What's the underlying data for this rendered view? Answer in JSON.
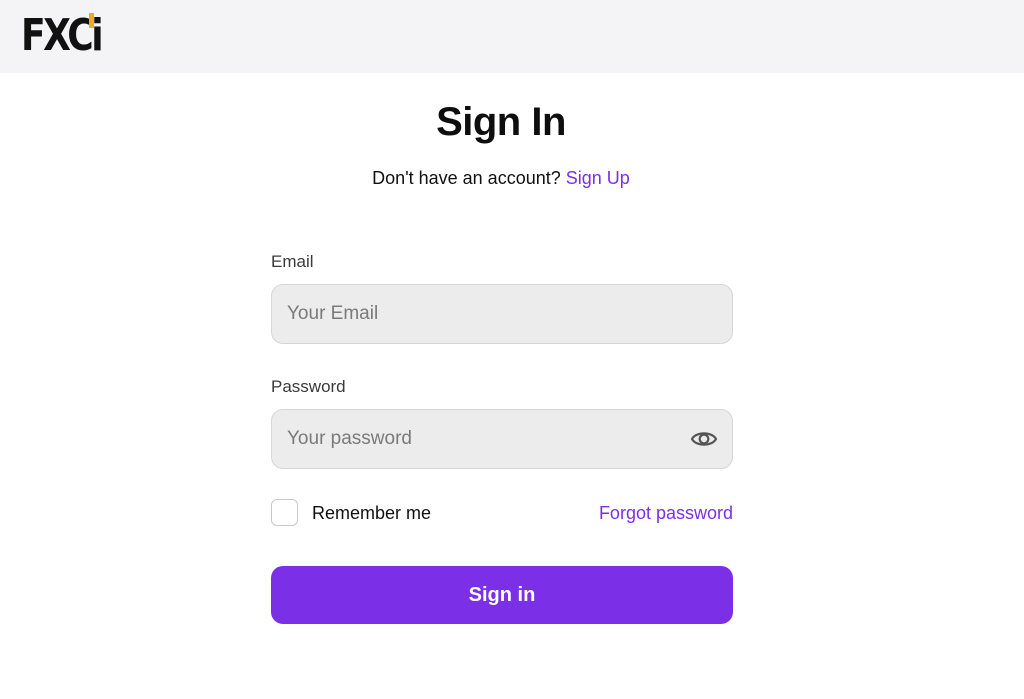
{
  "header": {
    "logo_text": "FXCi"
  },
  "title": "Sign In",
  "signup_prompt": {
    "text": "Don't have an account?",
    "link_label": "Sign Up"
  },
  "email": {
    "label": "Email",
    "placeholder": "Your Email",
    "value": ""
  },
  "password": {
    "label": "Password",
    "placeholder": "Your password",
    "value": "",
    "toggle_icon": "eye-icon"
  },
  "remember": {
    "label": "Remember me",
    "checked": false
  },
  "forgot_password_label": "Forgot password",
  "submit_label": "Sign in",
  "colors": {
    "accent": "#7b2fe6",
    "logo_mark": "#f5a623",
    "header_bg": "#f4f4f6",
    "input_bg": "#ececec"
  }
}
